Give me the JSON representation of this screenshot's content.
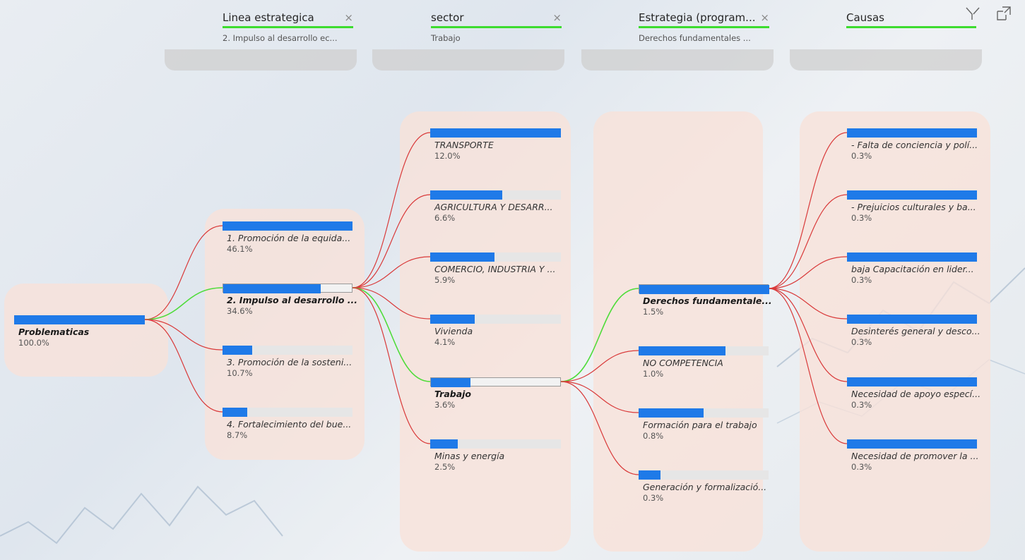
{
  "levels": [
    {
      "title": "Linea estrategica",
      "filter": "2. Impulso al desarrollo ec...",
      "close": "×"
    },
    {
      "title": "sector",
      "filter": "Trabajo",
      "close": "×"
    },
    {
      "title": "Estrategia (program...",
      "filter": "Derechos fundamentales ...",
      "close": "×"
    },
    {
      "title": "Causas",
      "filter": "",
      "close": ""
    }
  ],
  "root": {
    "label": "Problematicas",
    "value": "100.0%",
    "fraction": 1.0
  },
  "col1": [
    {
      "label": "1. Promoción de la equida...",
      "value": "46.1%",
      "fraction": 1.0,
      "selected": false
    },
    {
      "label": "2. Impulso al desarrollo ...",
      "value": "34.6%",
      "fraction": 0.75,
      "selected": true
    },
    {
      "label": "3. Promoción de la sosteni...",
      "value": "10.7%",
      "fraction": 0.23,
      "selected": false
    },
    {
      "label": "4. Fortalecimiento del bue...",
      "value": "8.7%",
      "fraction": 0.19,
      "selected": false
    }
  ],
  "col2": [
    {
      "label": "TRANSPORTE",
      "value": "12.0%",
      "fraction": 1.0,
      "selected": false
    },
    {
      "label": "AGRICULTURA Y DESARR...",
      "value": "6.6%",
      "fraction": 0.55,
      "selected": false
    },
    {
      "label": "COMERCIO, INDUSTRIA Y ...",
      "value": "5.9%",
      "fraction": 0.49,
      "selected": false
    },
    {
      "label": "Vivienda",
      "value": "4.1%",
      "fraction": 0.34,
      "selected": false
    },
    {
      "label": "Trabajo",
      "value": "3.6%",
      "fraction": 0.3,
      "selected": true
    },
    {
      "label": "Minas y energía",
      "value": "2.5%",
      "fraction": 0.21,
      "selected": false
    }
  ],
  "col3": [
    {
      "label": "Derechos fundamentale...",
      "value": "1.5%",
      "fraction": 1.0,
      "selected": true
    },
    {
      "label": "NO COMPETENCIA",
      "value": "1.0%",
      "fraction": 0.67,
      "selected": false
    },
    {
      "label": "Formación para el trabajo",
      "value": "0.8%",
      "fraction": 0.5,
      "selected": false
    },
    {
      "label": "Generación y formalizació...",
      "value": "0.3%",
      "fraction": 0.17,
      "selected": false
    }
  ],
  "col4": [
    {
      "label": "- Falta de conciencia y polí...",
      "value": "0.3%",
      "fraction": 1.0,
      "selected": false
    },
    {
      "label": "- Prejuicios culturales y ba...",
      "value": "0.3%",
      "fraction": 1.0,
      "selected": false
    },
    {
      "label": "baja Capacitación en lider...",
      "value": "0.3%",
      "fraction": 1.0,
      "selected": false
    },
    {
      "label": "Desinterés general y desco...",
      "value": "0.3%",
      "fraction": 1.0,
      "selected": false
    },
    {
      "label": "Necesidad de apoyo especí...",
      "value": "0.3%",
      "fraction": 1.0,
      "selected": false
    },
    {
      "label": "Necesidad de promover la ...",
      "value": "0.3%",
      "fraction": 1.0,
      "selected": false
    }
  ],
  "colors": {
    "bar": "#1f7ae8",
    "active_path": "#4fdc3a",
    "link": "#d93a3a",
    "panel": "#f8e1d8"
  },
  "toolbar": {
    "filter_icon": "filter-icon",
    "focus_icon": "focus-mode-icon"
  }
}
